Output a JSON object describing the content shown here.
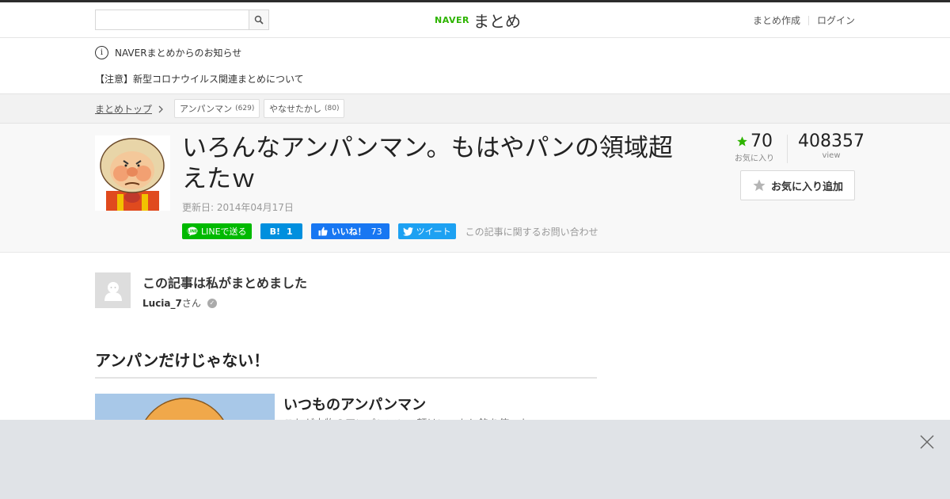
{
  "header": {
    "search_placeholder": "",
    "logo_brand": "NAVER",
    "logo_text": "まとめ",
    "links": [
      "まとめ作成",
      "ログイン"
    ]
  },
  "notices": {
    "info": "NAVERまとめからのお知らせ",
    "alert": "【注意】新型コロナウイルス関連まとめについて"
  },
  "breadcrumb": {
    "top": "まとめトップ",
    "tags": [
      {
        "label": "アンパンマン",
        "count": "(629)"
      },
      {
        "label": "やなせたかし",
        "count": "(80)"
      }
    ]
  },
  "article": {
    "title": "いろんなアンパンマン。もはやパンの領域超えたｗ",
    "updated": "更新日: 2014年04月17日",
    "share": {
      "line": "LINEで送る",
      "hatena_count": "1",
      "like_label": "いいね！",
      "like_count": "73",
      "tweet": "ツイート",
      "contact": "この記事に関するお問い合わせ"
    },
    "favorites": "70",
    "favorites_label": "お気に入り",
    "views": "408357",
    "views_label": "view",
    "fav_button": "お気に入り追加"
  },
  "author": {
    "heading": "この記事は私がまとめました",
    "name": "Lucia_7",
    "suffix": "さん"
  },
  "section": {
    "heading": "アンパンだけじゃない！",
    "item_title": "いつものアンパンマン",
    "item_desc": "これが本物のアンパンマン。顔はいつもと餡を使った"
  },
  "colors": {
    "naver_green": "#2db400",
    "line_green": "#00b900",
    "hatena_blue": "#008fde",
    "fb_blue": "#1877f2",
    "tw_blue": "#1da1f2"
  }
}
